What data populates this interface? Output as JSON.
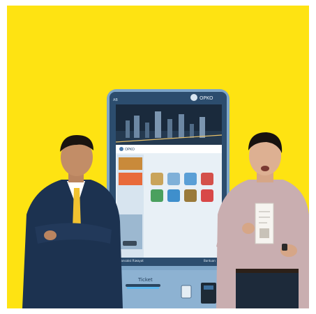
{
  "kiosk": {
    "brand_top": "OPKO",
    "brand_screen": "OPKO",
    "corner_label": "AB",
    "ticket_label": "Ticket",
    "footer_left": "Transaksi Riwayat",
    "footer_right": "Bantuan",
    "tiles": [
      {
        "name": "tile-1",
        "color": "#c9a45a"
      },
      {
        "name": "tile-2",
        "color": "#7fb0d8"
      },
      {
        "name": "tile-3",
        "color": "#5a9fd6"
      },
      {
        "name": "tile-4",
        "color": "#d4504a"
      },
      {
        "name": "tile-5",
        "color": "#4aa05e"
      },
      {
        "name": "tile-6",
        "color": "#3f8fcc"
      },
      {
        "name": "tile-7",
        "color": "#9a7a3a"
      },
      {
        "name": "tile-8",
        "color": "#d84848"
      }
    ]
  },
  "colors": {
    "background": "#fee312",
    "kiosk_body": "#7ea6c8",
    "screen_bg": "#e8f0f6",
    "suit": "#1c3250",
    "tie": "#f2c230",
    "shirt": "#c9aeb0"
  }
}
